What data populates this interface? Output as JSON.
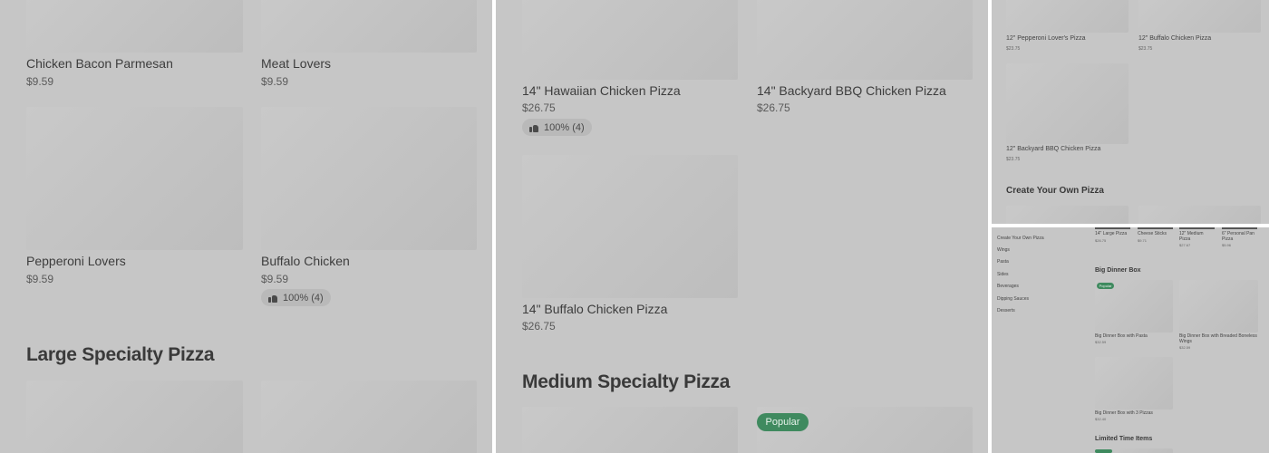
{
  "panel1": {
    "items": [
      {
        "name": "Chicken Bacon Parmesan",
        "price": "$9.59"
      },
      {
        "name": "Meat Lovers",
        "price": "$9.59"
      },
      {
        "name": "Pepperoni Lovers",
        "price": "$9.59"
      },
      {
        "name": "Buffalo Chicken",
        "price": "$9.59",
        "rating": "100% (4)"
      }
    ],
    "section_title": "Large Specialty Pizza"
  },
  "panel2": {
    "items": [
      {
        "name": "14\" Hawaiian Chicken Pizza",
        "price": "$26.75",
        "rating": "100% (4)"
      },
      {
        "name": "14\" Backyard BBQ Chicken Pizza",
        "price": "$26.75"
      },
      {
        "name": "14\" Buffalo Chicken Pizza",
        "price": "$26.75"
      }
    ],
    "section_title": "Medium Specialty Pizza",
    "badge": "Popular"
  },
  "panel3": {
    "items": [
      {
        "name": "12\" Pepperoni Lover's Pizza",
        "price": "$23.75"
      },
      {
        "name": "12\" Buffalo Chicken Pizza",
        "price": "$23.75"
      },
      {
        "name": "12\" Backyard BBQ Chicken Pizza",
        "price": "$23.75"
      }
    ],
    "section_title": "Create Your Own Pizza"
  },
  "panel4": {
    "nav": [
      "Create Your Own Pizza",
      "Wings",
      "Pasta",
      "Sides",
      "Beverages",
      "Dipping Sauces",
      "Desserts"
    ],
    "top_items": [
      {
        "name": "14\" Large Pizza",
        "price": "$26.75"
      },
      {
        "name": "Cheese Sticks",
        "price": "$9.71"
      },
      {
        "name": "12\" Medium Pizza",
        "price": "$27.67"
      },
      {
        "name": "6\" Personal Pan Pizza",
        "price": "$5.96"
      }
    ],
    "section_title": "Big Dinner Box",
    "badge": "Popular",
    "items": [
      {
        "name": "Big Dinner Box with Pasta",
        "price": "$32.59"
      },
      {
        "name": "Big Dinner Box with Breaded Boneless Wings",
        "price": "$32.59"
      },
      {
        "name": "Big Dinner Box with 3 Pizzas",
        "price": "$32.40"
      }
    ],
    "section_title_2": "Limited Time Items"
  },
  "colors": {
    "overlay": "#c6c6c6",
    "badge_green": "#3f8a5f",
    "divider": "#ffffff"
  }
}
